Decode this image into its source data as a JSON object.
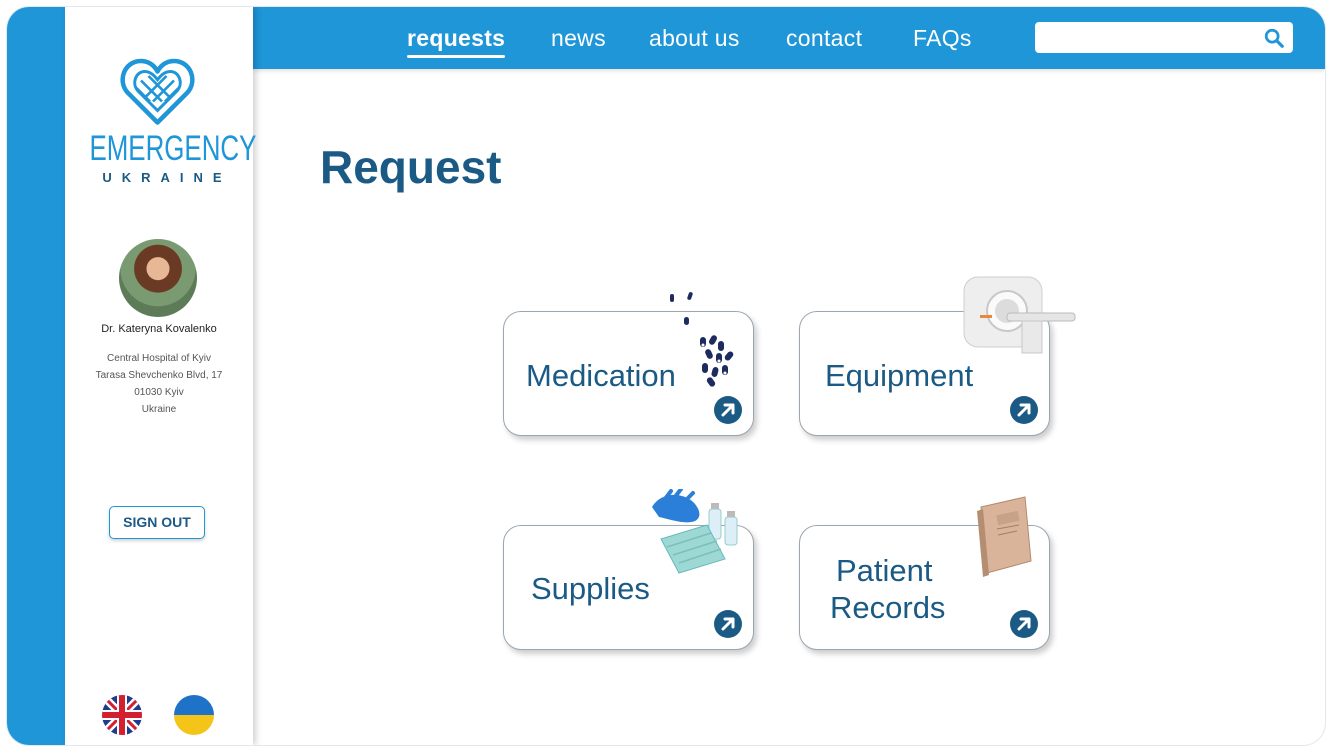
{
  "brand": {
    "name": "EMERGENCY",
    "country": "UKRAINE"
  },
  "nav": {
    "items": [
      {
        "label": "requests",
        "active": true
      },
      {
        "label": "news",
        "active": false
      },
      {
        "label": "about us",
        "active": false
      },
      {
        "label": "contact",
        "active": false
      },
      {
        "label": "FAQs",
        "active": false
      }
    ],
    "search": {
      "value": "",
      "placeholder": ""
    }
  },
  "profile": {
    "name": "Dr. Kateryna Kovalenko",
    "address": [
      "Central Hospital of Kyiv",
      "Tarasa Shevchenko Blvd, 17",
      "01030 Kyiv",
      "Ukraine"
    ]
  },
  "signout_label": "SIGN OUT",
  "page_title": "Request",
  "cards": [
    {
      "label": "Medication"
    },
    {
      "label": "Equipment"
    },
    {
      "label": "Supplies"
    },
    {
      "label_line1": "Patient",
      "label_line2": "Records"
    }
  ],
  "colors": {
    "primary": "#1e96d8",
    "dark": "#1b5a85"
  },
  "icons": [
    "search-icon",
    "heart-knot-logo",
    "arrow-circle-icon",
    "uk-flag-icon",
    "ukraine-flag-icon"
  ]
}
